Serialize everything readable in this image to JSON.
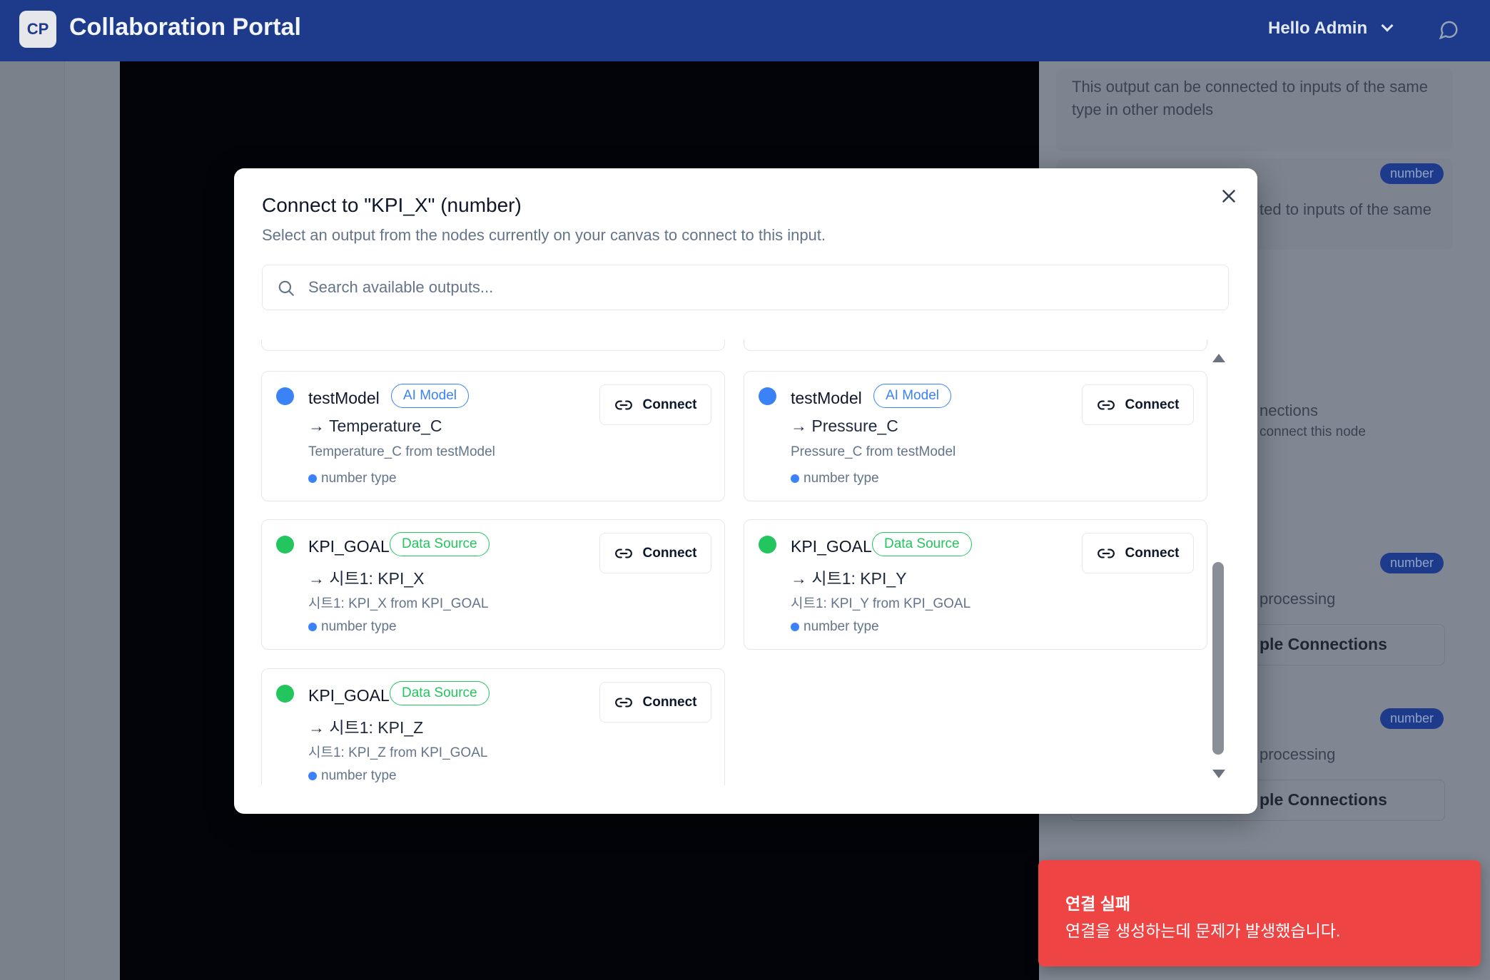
{
  "header": {
    "logo_text": "CP",
    "title": "Collaboration Portal",
    "user_greeting": "Hello Admin"
  },
  "right_panel": {
    "card1_desc": "This output can be connected to inputs of the same type in other models",
    "card2_badge": "number",
    "card2_desc_partial": "ted to inputs of the same",
    "connections_partial": "nections",
    "connect_hint_partial": "connect this node",
    "card3_badge": "number",
    "card3_desc_partial": "processing",
    "card3_btn_partial": "ple Connections",
    "card4_badge": "number",
    "card4_desc_partial": "processing",
    "card4_btn_partial": "ple Connections"
  },
  "modal": {
    "title": "Connect to \"KPI_X\" (number)",
    "subtitle": "Select an output from the nodes currently on your canvas to connect to this input.",
    "search_placeholder": "Search available outputs...",
    "connect_label": "Connect",
    "outputs": [
      {
        "model": "testModel",
        "badge": "AI Model",
        "badge_kind": "ai",
        "dot_color": "#3b82f6",
        "output": "→ Temperature_C",
        "desc": "Temperature_C from testModel",
        "type": "number type"
      },
      {
        "model": "testModel",
        "badge": "AI Model",
        "badge_kind": "ai",
        "dot_color": "#3b82f6",
        "output": "→ Pressure_C",
        "desc": "Pressure_C from testModel",
        "type": "number type"
      },
      {
        "model": "KPI_GOAL",
        "badge": "Data Source",
        "badge_kind": "ds",
        "dot_color": "#22c55e",
        "output": "→ 시트1: KPI_X",
        "desc": "시트1: KPI_X from KPI_GOAL",
        "type": "number type"
      },
      {
        "model": "KPI_GOAL",
        "badge": "Data Source",
        "badge_kind": "ds",
        "dot_color": "#22c55e",
        "output": "→ 시트1: KPI_Y",
        "desc": "시트1: KPI_Y from KPI_GOAL",
        "type": "number type"
      },
      {
        "model": "KPI_GOAL",
        "badge": "Data Source",
        "badge_kind": "ds",
        "dot_color": "#22c55e",
        "output": "→ 시트1: KPI_Z",
        "desc": "시트1: KPI_Z from KPI_GOAL",
        "type": "number type"
      }
    ]
  },
  "toast": {
    "title": "연결 실패",
    "message": "연결을 생성하는데 문제가 발생했습니다.",
    "color": "#ef4444"
  },
  "colors": {
    "header_bg": "#1e3a8a",
    "ai_blue": "#3b82f6",
    "source_green": "#22c55e"
  }
}
